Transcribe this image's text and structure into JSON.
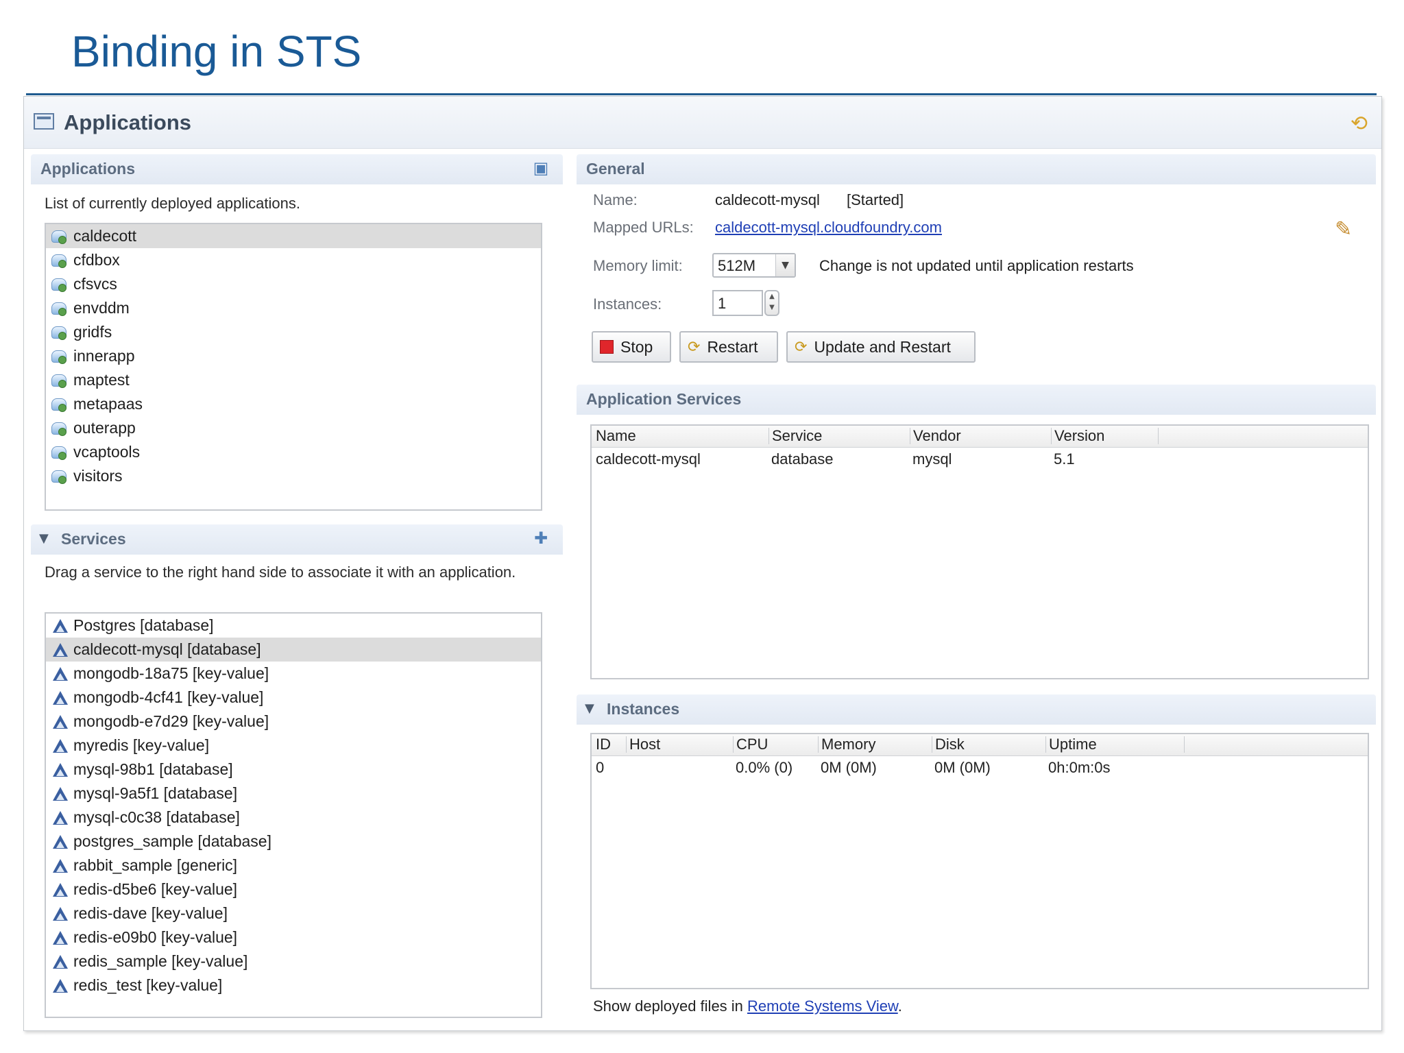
{
  "slide": {
    "title": "Binding in STS"
  },
  "editor": {
    "title": "Applications"
  },
  "applications": {
    "section_title": "Applications",
    "description": "List of currently deployed applications.",
    "items": [
      "caldecott",
      "cfdbox",
      "cfsvcs",
      "envddm",
      "gridfs",
      "innerapp",
      "maptest",
      "metapaas",
      "outerapp",
      "vcaptools",
      "visitors"
    ],
    "selected": "caldecott"
  },
  "services": {
    "section_title": "Services",
    "description": "Drag a service to the right hand side to associate it with an application.",
    "items": [
      "Postgres [database]",
      "caldecott-mysql [database]",
      "mongodb-18a75 [key-value]",
      "mongodb-4cf41 [key-value]",
      "mongodb-e7d29 [key-value]",
      "myredis [key-value]",
      "mysql-98b1 [database]",
      "mysql-9a5f1 [database]",
      "mysql-c0c38 [database]",
      "postgres_sample [database]",
      "rabbit_sample [generic]",
      "redis-d5be6 [key-value]",
      "redis-dave [key-value]",
      "redis-e09b0 [key-value]",
      "redis_sample [key-value]",
      "redis_test [key-value]"
    ],
    "selected": "caldecott-mysql [database]"
  },
  "general": {
    "section_title": "General",
    "name_label": "Name:",
    "name_value": "caldecott-mysql",
    "status": "[Started]",
    "urls_label": "Mapped URLs:",
    "url_value": "caldecott-mysql.cloudfoundry.com",
    "memory_label": "Memory limit:",
    "memory_value": "512M",
    "memory_note": "Change is not updated until application restarts",
    "instances_label": "Instances:",
    "instances_value": "1",
    "buttons": {
      "stop": "Stop",
      "restart": "Restart",
      "update_restart": "Update and Restart"
    }
  },
  "app_services": {
    "section_title": "Application Services",
    "columns": [
      "Name",
      "Service",
      "Vendor",
      "Version"
    ],
    "rows": [
      [
        "caldecott-mysql",
        "database",
        "mysql",
        "5.1"
      ]
    ]
  },
  "instances": {
    "section_title": "Instances",
    "columns": [
      "ID",
      "Host",
      "CPU",
      "Memory",
      "Disk",
      "Uptime"
    ],
    "rows": [
      [
        "0",
        "",
        "0.0% (0)",
        "0M (0M)",
        "0M (0M)",
        "0h:0m:0s"
      ]
    ]
  },
  "footer": {
    "prefix": "Show deployed files in ",
    "link": "Remote Systems View",
    "suffix": "."
  },
  "icons": {
    "editor": "applications-editor-icon",
    "refresh": "refresh-icon",
    "edit": "pencil-icon",
    "add_service": "add-service-icon",
    "deploy": "deploy-icon"
  }
}
